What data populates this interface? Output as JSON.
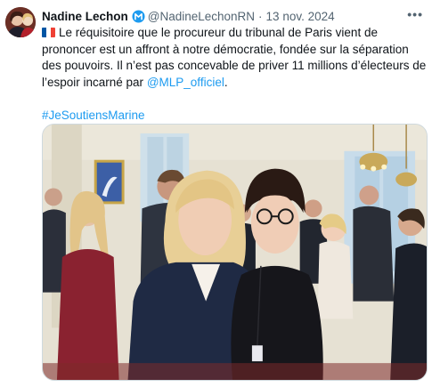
{
  "tweet": {
    "author_name": "Nadine Lechon",
    "verified_badge": "verified-badge-icon",
    "handle": "@NadineLechonRN",
    "separator": "·",
    "date": "13 nov. 2024",
    "more_icon": "more-options-icon",
    "text_line_1": "Le réquisitoire que le procureur du tribunal de Paris vient de prononcer est un affront à notre démocratie, fondée sur la séparation des pouvoirs. Il n’est pas concevable de priver 11 millions d’électeurs de l’espoir incarné par",
    "mention": "@MLP_officiel",
    "period": ".",
    "hashtag": "#JeSoutiensMarine",
    "flag_icon": "france-flag-icon",
    "colors": {
      "link": "#1d9bf0",
      "secondary_text": "#536471",
      "badge": "#1d9bf0"
    }
  }
}
